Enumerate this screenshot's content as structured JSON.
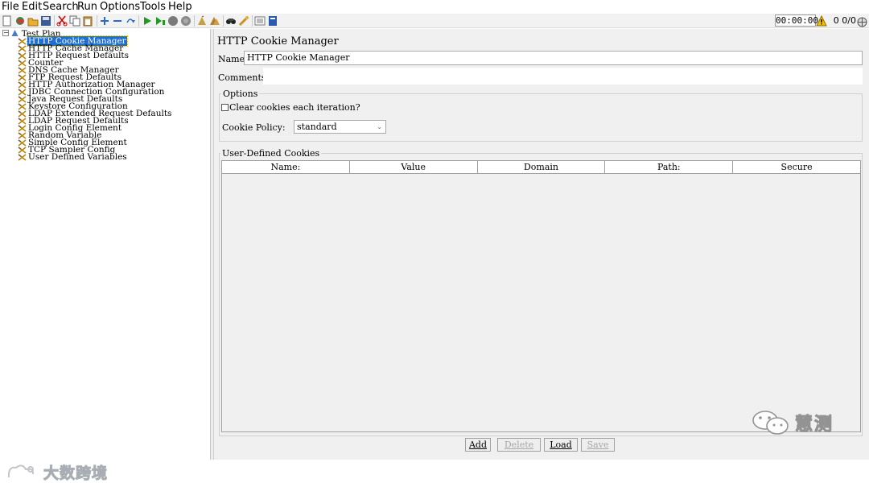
{
  "menu": {
    "items": [
      {
        "label": "File"
      },
      {
        "label": "Edit"
      },
      {
        "label": "Search"
      },
      {
        "label": "Run"
      },
      {
        "label": "Options"
      },
      {
        "label": "Tools"
      },
      {
        "label": "Help"
      }
    ]
  },
  "toolbar": {
    "timer": "00:00:00",
    "counts": "0 0/0"
  },
  "tree": {
    "root": "Test Plan",
    "items": [
      {
        "label": "HTTP Cookie Manager"
      },
      {
        "label": "HTTP Cache Manager"
      },
      {
        "label": "HTTP Request Defaults"
      },
      {
        "label": "Counter"
      },
      {
        "label": "DNS Cache Manager"
      },
      {
        "label": "FTP Request Defaults"
      },
      {
        "label": "HTTP Authorization Manager"
      },
      {
        "label": "JDBC Connection Configuration"
      },
      {
        "label": "Java Request Defaults"
      },
      {
        "label": "Keystore Configuration"
      },
      {
        "label": "LDAP Extended Request Defaults"
      },
      {
        "label": "LDAP Request Defaults"
      },
      {
        "label": "Login Config Element"
      },
      {
        "label": "Random Variable"
      },
      {
        "label": "Simple Config Element"
      },
      {
        "label": "TCP Sampler Config"
      },
      {
        "label": "User Defined Variables"
      }
    ],
    "selected_index": 0
  },
  "panel": {
    "title": "HTTP Cookie Manager",
    "name_label": "Name:",
    "name_value": "HTTP Cookie Manager",
    "comments_label": "Comments:",
    "comments_value": "",
    "options_label": "Options",
    "clear_cookies_label": "Clear cookies each iteration?",
    "clear_cookies_checked": false,
    "policy_label": "Cookie Policy:",
    "policy_value": "standard",
    "cookies_label": "User-Defined Cookies",
    "columns": [
      "Name:",
      "Value",
      "Domain",
      "Path:",
      "Secure"
    ],
    "buttons": {
      "add": "Add",
      "delete": "Delete",
      "load": "Load",
      "save": "Save"
    }
  },
  "watermarks": {
    "left": "大数跨境",
    "right": "慧测"
  },
  "colors": {
    "selection": "#1d6fd6",
    "panel_bg": "#f0f0f0",
    "warning": "#f5c000"
  }
}
